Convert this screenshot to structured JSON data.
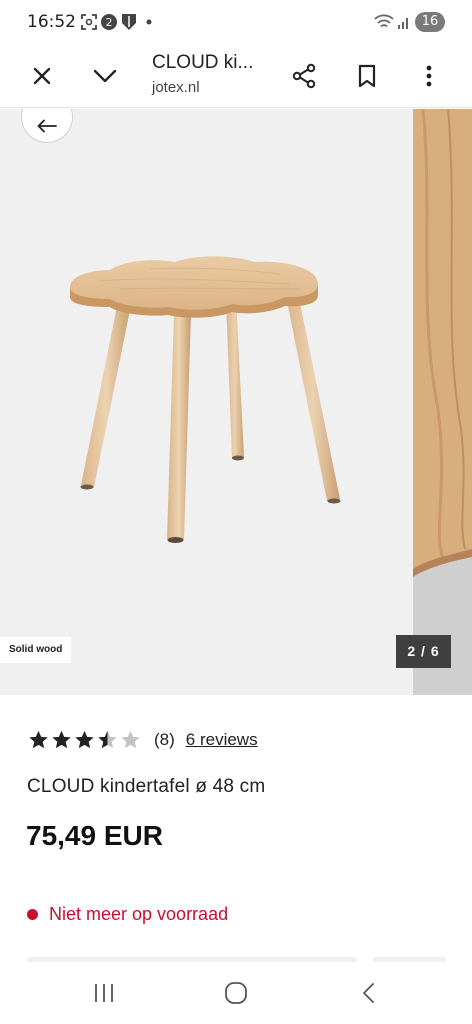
{
  "status_bar": {
    "time": "16:52",
    "battery": "16",
    "icons": [
      "screenshot-icon",
      "notification-badge-icon",
      "shield-icon",
      "dot-icon",
      "wifi-icon",
      "signal-icon"
    ]
  },
  "browser": {
    "page_title": "CLOUD ki...",
    "url": "jotex.nl",
    "icons": [
      "close-icon",
      "chevron-down-icon",
      "share-icon",
      "bookmark-icon",
      "more-vert-icon"
    ]
  },
  "gallery": {
    "badge": "Solid wood",
    "counter": "2 / 6",
    "back_icon": "arrow-left-icon"
  },
  "product": {
    "rating": 3.5,
    "rating_max": 5,
    "rating_count": "(8)",
    "reviews_link": "6 reviews",
    "title": "CLOUD kindertafel ø 48 cm",
    "price": "75,49 EUR",
    "stock_status": "Niet meer op voorraad"
  },
  "colors": {
    "accent_red": "#c8102e",
    "text": "#222222",
    "counter_bg": "#3f3f3f"
  },
  "navigation": {
    "icons": [
      "recent-apps-icon",
      "home-icon",
      "back-icon"
    ]
  }
}
